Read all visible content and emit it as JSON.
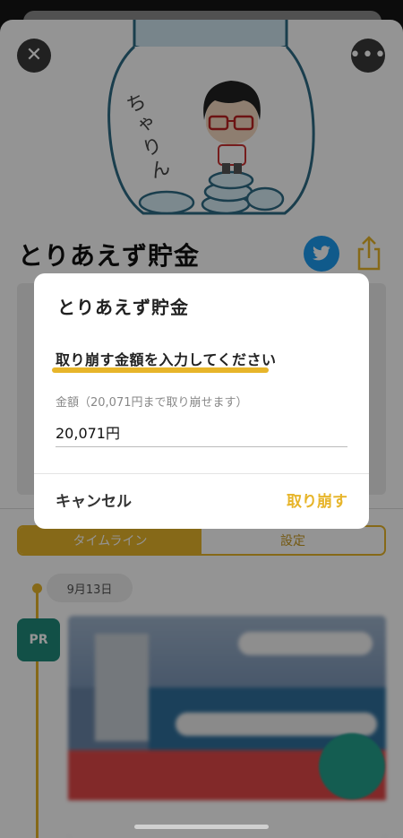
{
  "page": {
    "title": "とりあえず貯金",
    "jar_handwriting": "ちゃりん"
  },
  "tabs": [
    {
      "label": "タイムライン",
      "active": true
    },
    {
      "label": "設定",
      "active": false
    }
  ],
  "timeline": {
    "date": "9月13日",
    "badge": "PR"
  },
  "dialog": {
    "title": "とりあえず貯金",
    "prompt": "取り崩す金額を入力してください",
    "field_label": "金額（20,071円まで取り崩せます）",
    "field_value": "20,071円",
    "cancel_label": "キャンセル",
    "confirm_label": "取り崩す"
  },
  "icons": {
    "close": "close-icon",
    "more": "more-icon",
    "twitter": "twitter-icon",
    "share": "share-icon"
  },
  "colors": {
    "accent": "#e7b52a",
    "twitter": "#1d9bf0",
    "pr_badge": "#1f8a7a"
  }
}
